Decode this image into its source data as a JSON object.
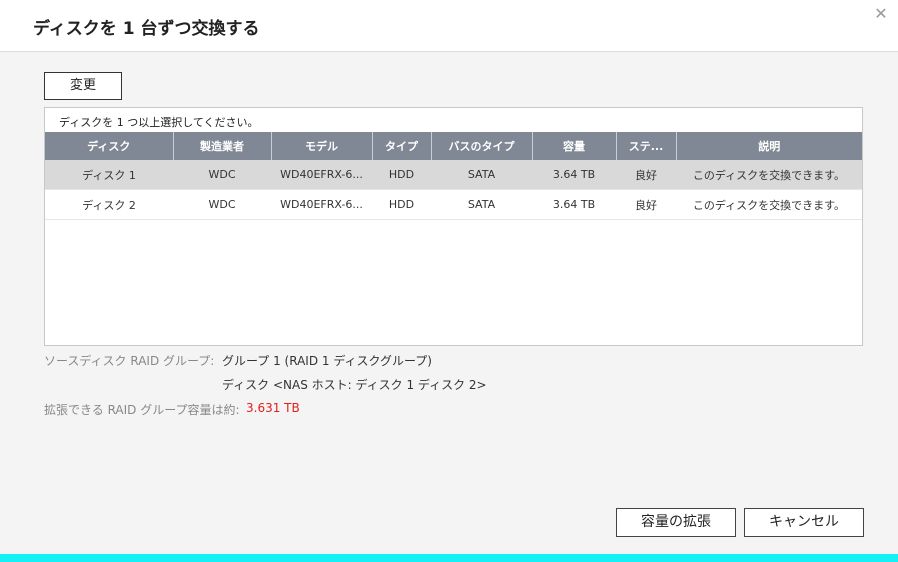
{
  "dialog": {
    "title": "ディスクを 1 台ずつ交換する",
    "close_glyph": "✕"
  },
  "toolbar": {
    "change_label": "変更"
  },
  "table": {
    "instruction": "ディスクを 1 つ以上選択してください。",
    "headers": [
      "ディスク",
      "製造業者",
      "モデル",
      "タイプ",
      "バスのタイプ",
      "容量",
      "ステ...",
      "説明"
    ],
    "rows": [
      [
        "ディスク 1",
        "WDC",
        "WD40EFRX-6...",
        "HDD",
        "SATA",
        "3.64 TB",
        "良好",
        "このディスクを交換できます。"
      ],
      [
        "ディスク 2",
        "WDC",
        "WD40EFRX-6...",
        "HDD",
        "SATA",
        "3.64 TB",
        "良好",
        "このディスクを交換できます。"
      ]
    ]
  },
  "info": {
    "source_label": "ソースディスク RAID グループ:",
    "source_value": "グループ 1 (RAID 1 ディスクグループ)",
    "source_disks": "ディスク <NAS ホスト: ディスク 1 ディスク 2>",
    "capacity_label": "拡張できる RAID グループ容量は約:",
    "capacity_value": "3.631 TB"
  },
  "footer": {
    "expand_label": "容量の拡張",
    "cancel_label": "キャンセル"
  },
  "colors": {
    "header_bg": "#808795",
    "selected_row": "#d9d9d9",
    "capacity_red": "#e0201b",
    "bottom_bar": "#14f0f4"
  }
}
